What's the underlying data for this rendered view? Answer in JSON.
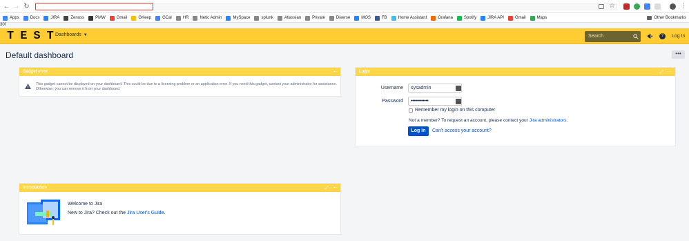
{
  "browser": {
    "bookmarks": [
      {
        "label": "Apps",
        "color": "#4285f4"
      },
      {
        "label": "Docs",
        "color": "#4285f4"
      },
      {
        "label": "JIRA",
        "color": "#2684ff"
      },
      {
        "label": "Zenoss",
        "color": "#444444"
      },
      {
        "label": "PMW",
        "color": "#333333"
      },
      {
        "label": "Gmail",
        "color": "#ea4335"
      },
      {
        "label": "GKeep",
        "color": "#fbbc04"
      },
      {
        "label": "GCal",
        "color": "#4285f4"
      },
      {
        "label": "HR",
        "color": "#888888"
      },
      {
        "label": "Netic Admin",
        "color": "#888888"
      },
      {
        "label": "MySpace",
        "color": "#2684ff"
      },
      {
        "label": "splunk",
        "color": "#888888"
      },
      {
        "label": "Atlassian",
        "color": "#888888"
      },
      {
        "label": "Private",
        "color": "#888888"
      },
      {
        "label": "Diverse",
        "color": "#888888"
      },
      {
        "label": "MOS",
        "color": "#2684ff"
      },
      {
        "label": "FB",
        "color": "#3b5998"
      },
      {
        "label": "Home Assistant",
        "color": "#41bdf5"
      },
      {
        "label": "Grafana",
        "color": "#f46800"
      },
      {
        "label": "Spotify",
        "color": "#1db954"
      },
      {
        "label": "JIRA API",
        "color": "#2684ff"
      },
      {
        "label": "Gmail",
        "color": "#ea4335"
      },
      {
        "label": "Maps",
        "color": "#34a853"
      }
    ],
    "other_bookmarks": "Other Bookmarks",
    "page_tag": "30f"
  },
  "header": {
    "logo": "TEST",
    "dashboards_menu": "Dashboards",
    "search_placeholder": "Search",
    "login": "Log In",
    "accent": "#ffcc33"
  },
  "page": {
    "title": "Default dashboard",
    "more": "•••"
  },
  "gadgets": {
    "error": {
      "title": "Gadget error",
      "message": "This gadget cannot be displayed on your dashboard. This could be due to a licensing problem or an application error. If you need this gadget, contact your administrator for assistance. Otherwise, you can remove it from your dashboard."
    },
    "login": {
      "title": "Login",
      "username_label": "Username",
      "username_value": "sysadmin",
      "password_label": "Password",
      "password_value": "•••••••••••••",
      "remember": "Remember my login on this computer",
      "member_prefix": "Not a member? To request an account, please contact your",
      "member_link": "Jira administrators",
      "member_suffix": ".",
      "login_button": "Log In",
      "cant_access": "Can't access your account?"
    },
    "intro": {
      "title": "Introduction",
      "welcome": "Welcome to Jira",
      "new_prefix": "New to Jira? Check out the",
      "guide_link": "Jira User's Guide",
      "new_suffix": "."
    }
  }
}
